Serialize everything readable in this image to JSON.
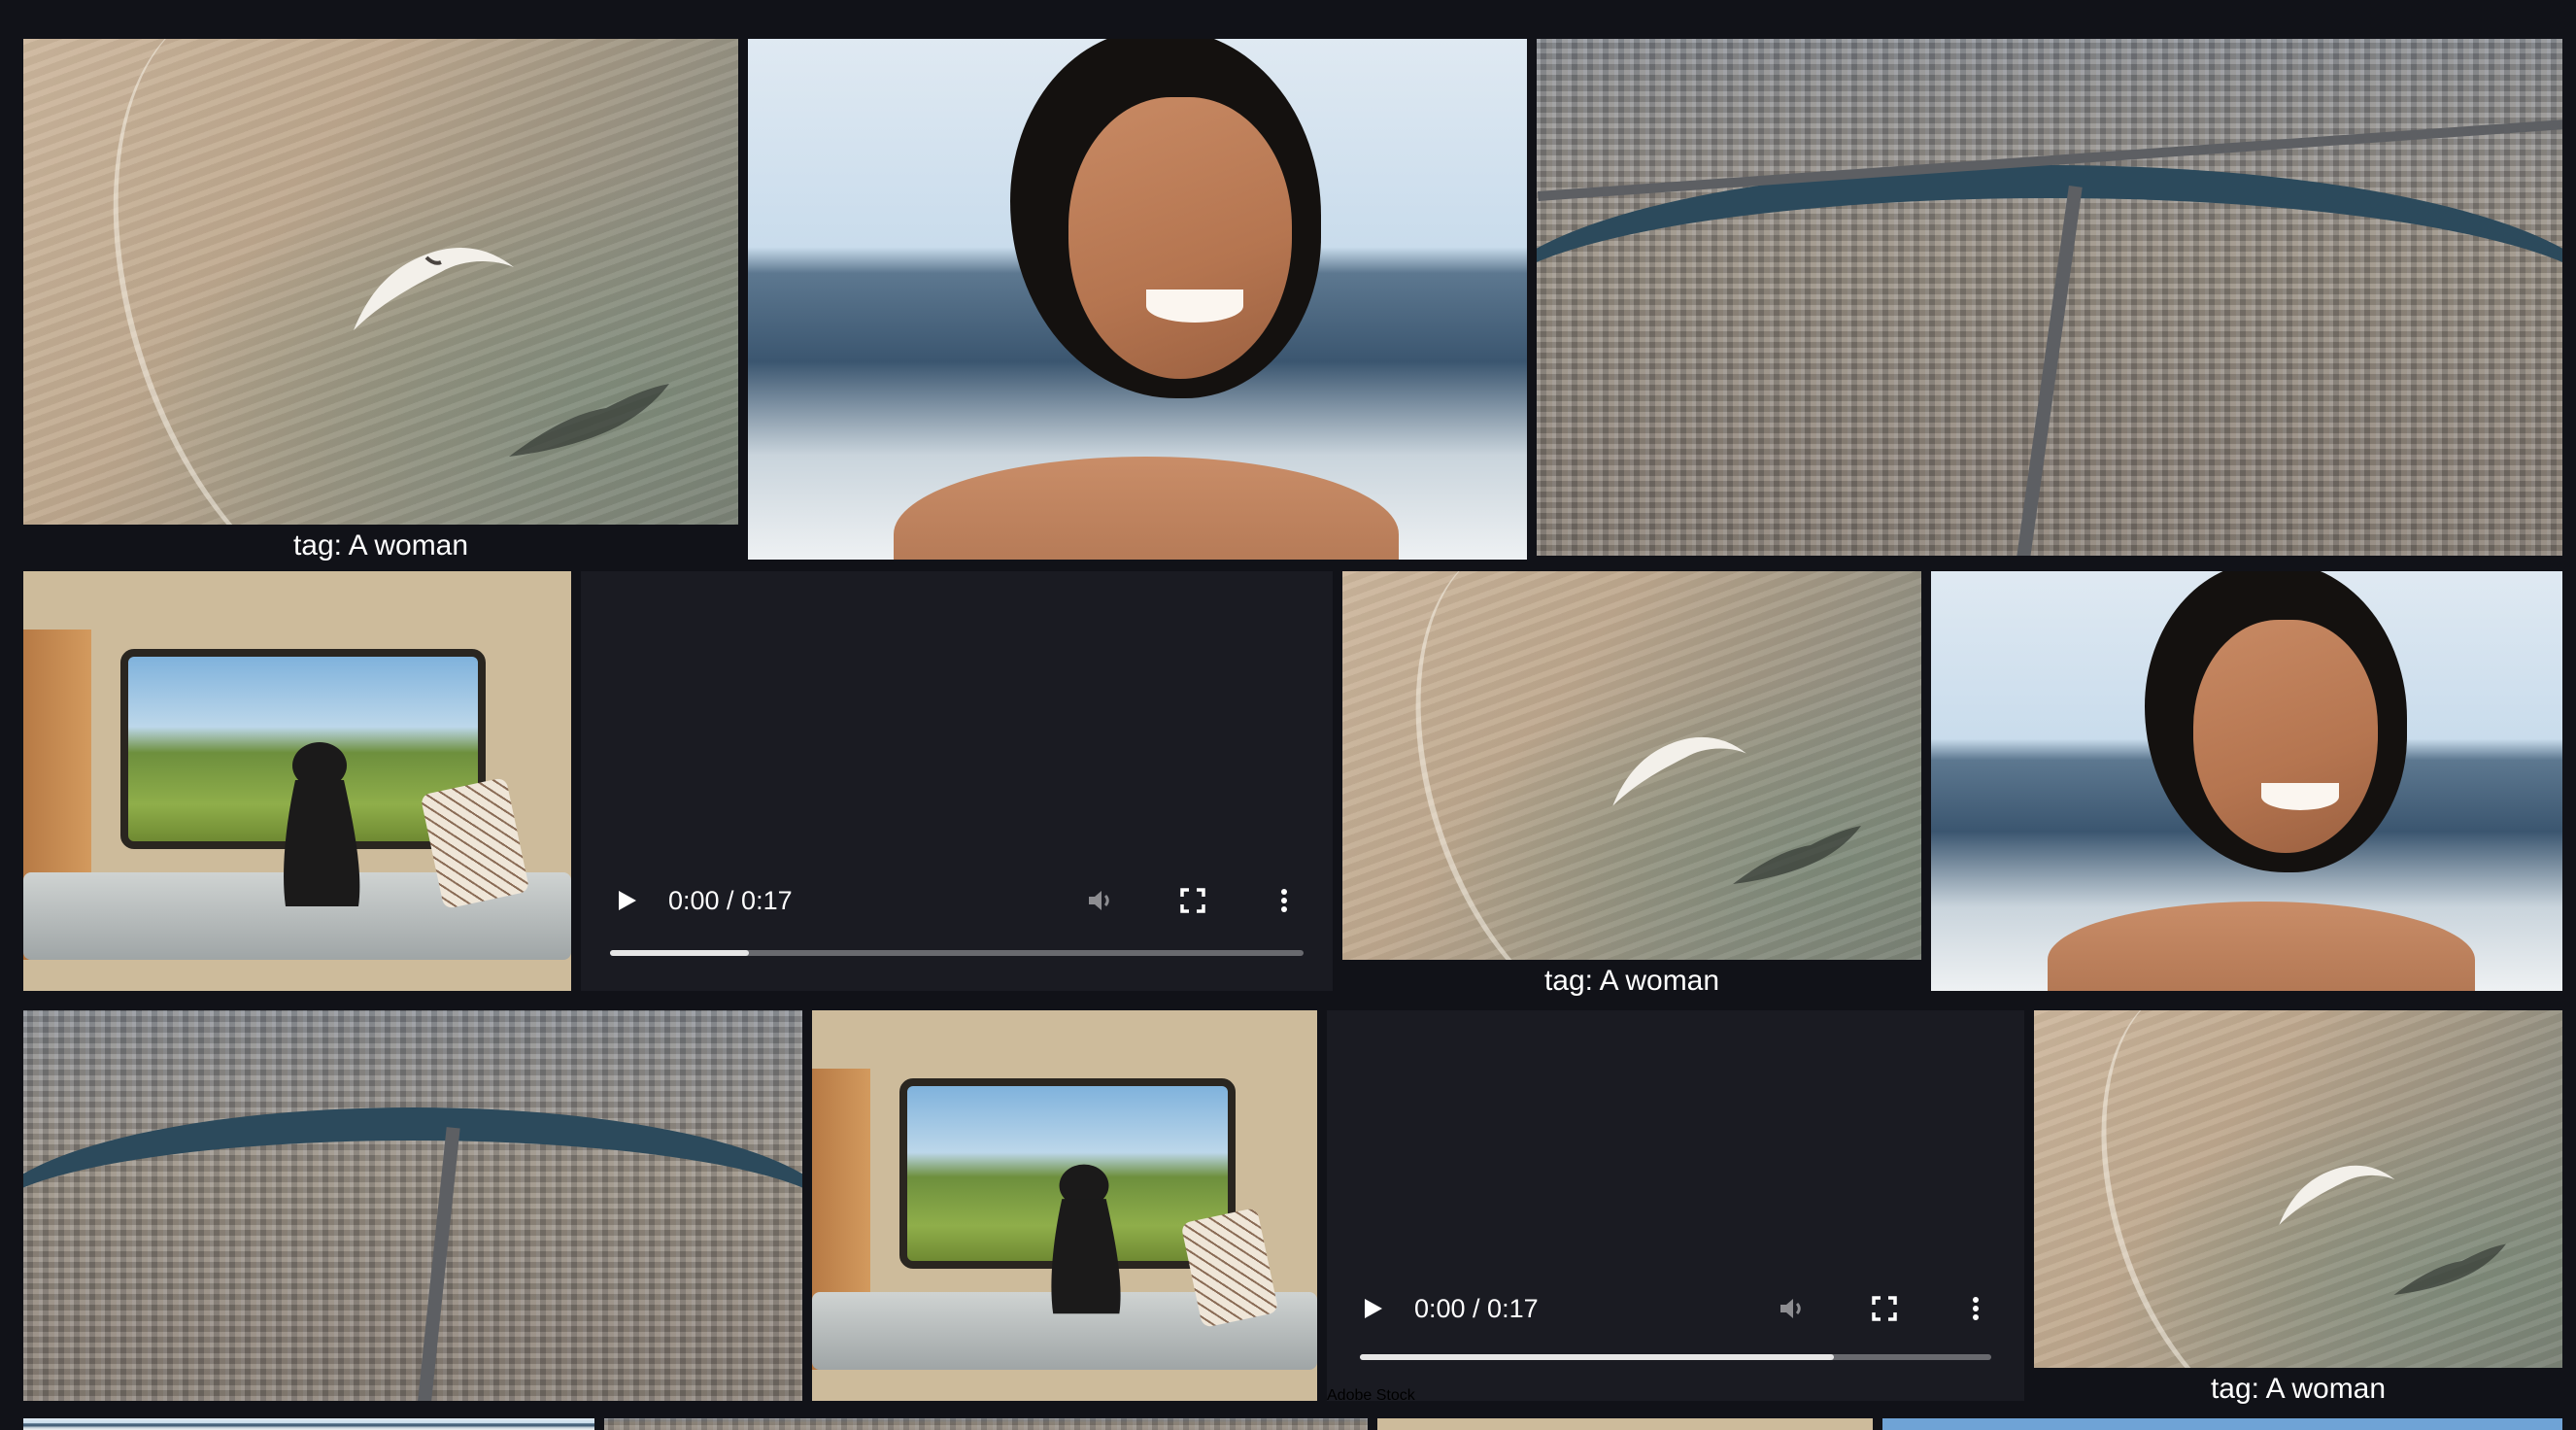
{
  "colors": {
    "page_background": "#111218",
    "caption_text": "#ffffff",
    "video_progress_fill": "#e6e6e6"
  },
  "icons": {
    "play": "play-icon",
    "volume": "volume-icon",
    "fullscreen": "fullscreen-icon",
    "more": "more-options-icon"
  },
  "gallery": {
    "caption_text": "tag: A woman",
    "video_watermark": "Adobe Stock",
    "video_1": {
      "time": "0:00 / 0:17",
      "progress": 0.2
    },
    "video_2": {
      "time": "0:00 / 0:17",
      "progress": 0.75
    }
  }
}
